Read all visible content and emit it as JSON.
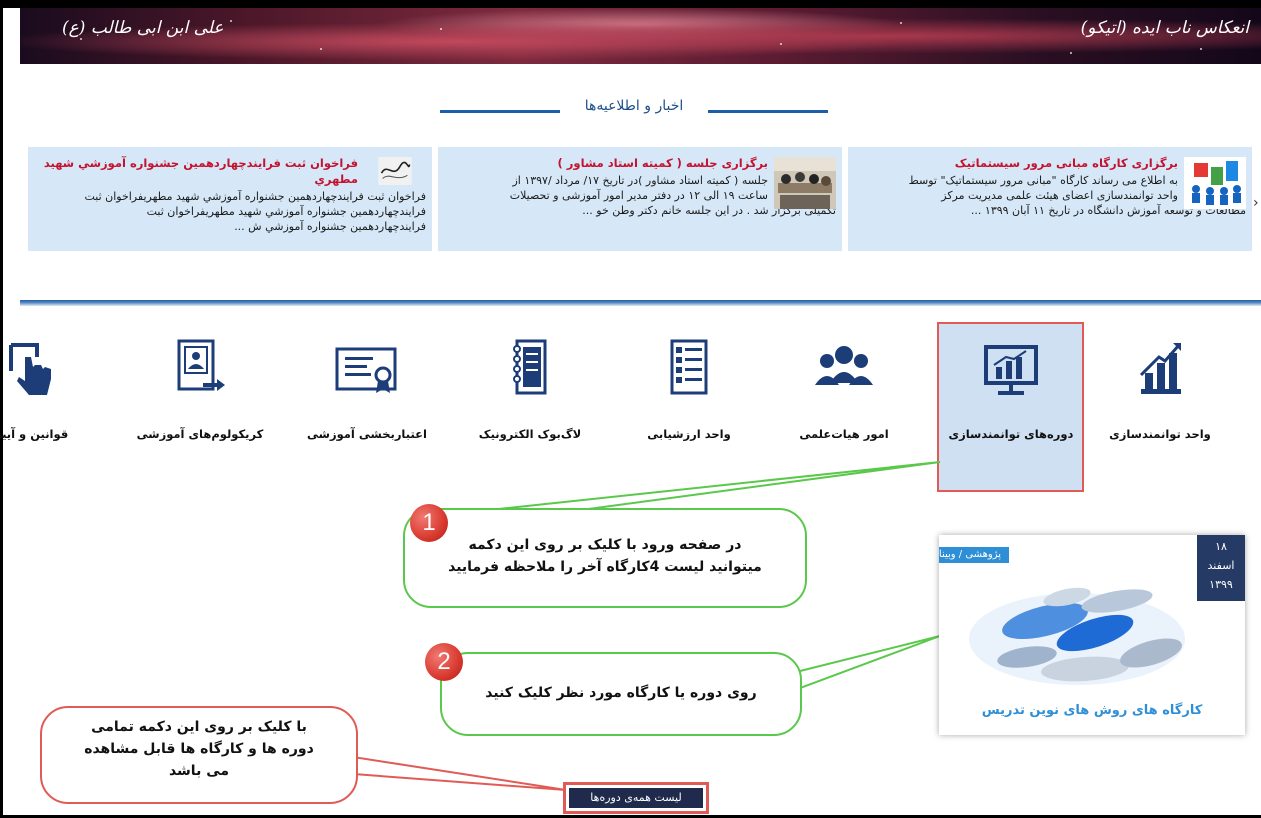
{
  "banner": {
    "right_quote": "انعکاس ناب ایده (اتیکو)",
    "left_quote": "علی ابن ابی طالب (ع)"
  },
  "news": {
    "section_title": "اخبار و اطلاعیه‌ها",
    "items": [
      {
        "title": "برگزاری کارگاه مبانی مرور سیستماتیک",
        "body_lines": [
          "به اطلاع می رساند کارگاه \"مبانی مرور سیستماتیک\" توسط",
          "واحد توانمندسازی اعضای هیئت علمی مدیریت مرکز",
          "مطالعات و توسعه آموزش دانشگاه در تاریخ ۱۱ آبان ۱۳۹۹ ..."
        ]
      },
      {
        "title": "برگزاری جلسه ( کمیته استاد مشاور )",
        "body_lines": [
          "جلسه ( کمیته استاد مشاور )در تاریخ ۱۷/ مرداد /۱۳۹۷ از",
          "ساعت ۱۹ الی ۱۲ در دفتر مدیر امور آموزشی و تحصیلات",
          "تکمیلی برگزار شد . در این جلسه خانم دکتر وطن خو ..."
        ]
      },
      {
        "title_lines": [
          "فراخوان ثبت فرایندچهاردهمین جشنواره آموزشي شهيد",
          "مطهري"
        ],
        "body_lines": [
          "فراخوان ثبت فرایندچهاردهمین جشنواره آموزشي شهيد مطهريفراخوان ثبت",
          "فرایندچهاردهمین جشنواره آموزشي شهيد مطهريفراخوان ثبت",
          "فرایندچهاردهمین جشنواره آموزشي ش ..."
        ]
      }
    ]
  },
  "services": [
    {
      "label": "واحد توانمندسازی",
      "icon": "bar-chart-icon"
    },
    {
      "label": "دوره‌های توانمندسازی",
      "icon": "presentation-chart-icon"
    },
    {
      "label": "امور هیات‌علمی",
      "icon": "people-group-icon"
    },
    {
      "label": "واحد ارزشیابی",
      "icon": "checklist-icon"
    },
    {
      "label": "لاگ‌بوک الکترونیک",
      "icon": "notebook-icon"
    },
    {
      "label": "اعتباربخشی آموزشی",
      "icon": "certificate-icon"
    },
    {
      "label": "کریکولوم‌های آموزشی",
      "icon": "contact-card-export-icon"
    },
    {
      "label": "قوانین و آیین",
      "icon": "pointer-hand-icon"
    }
  ],
  "callouts": {
    "c1_number": "1",
    "c1_line1": "در صفحه ورود با کلیک بر روی این دکمه",
    "c1_line2": "میتوانید لیست 4کارگاه آخر را ملاحظه فرمایید",
    "c2_number": "2",
    "c2_text": "روی دوره یا کارگاه مورد نظر کلیک کنید",
    "c3_line1": "با کلیک بر روی این دکمه تمامی",
    "c3_line2": "دوره ها و کارگاه ها قابل مشاهده",
    "c3_line3": "می باشد"
  },
  "course": {
    "day": "۱۸",
    "month": "اسفند",
    "year": "۱۳۹۹",
    "category": "پژوهشی / وبینار آموزشی",
    "title": "کارگاه های روش های نوین تدریس"
  },
  "all_courses_button": "لیست همه‌ی دوره‌ها",
  "colors": {
    "news_title_red": "#c4122f",
    "card_bg": "#d6e8f7",
    "accent_blue": "#1b5fa8",
    "callout_green": "#5ac84a",
    "highlight_red": "#e05b55",
    "course_blue": "#2f8fd6",
    "date_navy": "#263a66"
  }
}
